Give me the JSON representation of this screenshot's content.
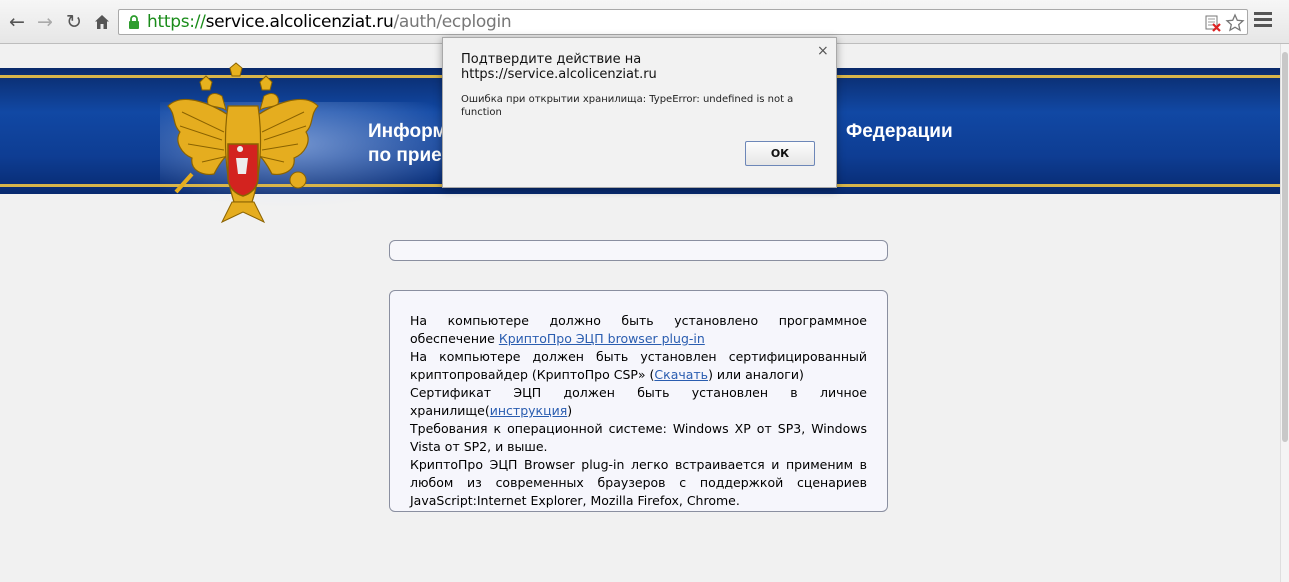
{
  "browser": {
    "url_scheme": "https",
    "url_separator": "://",
    "url_host": "service.alcolicenziat.ru",
    "url_path": "/auth/ecplogin",
    "icons": {
      "back": "back-arrow-icon",
      "forward": "forward-arrow-icon",
      "reload": "reload-icon",
      "home": "home-icon",
      "lock": "lock-icon",
      "blocked": "blocked-plugin-icon",
      "star": "star-icon",
      "menu": "menu-icon"
    }
  },
  "banner": {
    "title_line1_visible": "Информ",
    "title_line2_visible": "по прие",
    "title_right_visible": "Федерации"
  },
  "info": {
    "para1_text": "На компьютере должно быть установлено программное обеспечение",
    "para1_link": "КриптоПро ЭЦП browser plug-in",
    "para2_text": "На компьютере должен быть установлен сертифицированный криптопровайдер (КриптоПро CSP» (",
    "para2_link": "Скачать",
    "para2_tail": ") или аналоги)",
    "para3_text": "Сертификат ЭЦП должен быть установлен в личное хранилище(",
    "para3_link": "инструкция",
    "para3_tail": ")",
    "para4_text": "Требования к операционной системе: Windows XP от SP3, Windows Vista от SP2, и выше.",
    "para5_text": "КриптоПро ЭЦП Browser plug-in легко встраивается и применим в любом из современных браузеров с поддержкой сценариев JavaScript:Internet Explorer, Mozilla Firefox, Chrome."
  },
  "dialog": {
    "title": "Подтвердите действие на https://service.alcolicenziat.ru",
    "message": "Ошибка при открытии хранилища: TypeError: undefined is not a function",
    "ok_label": "ОК",
    "close_label": "×"
  }
}
